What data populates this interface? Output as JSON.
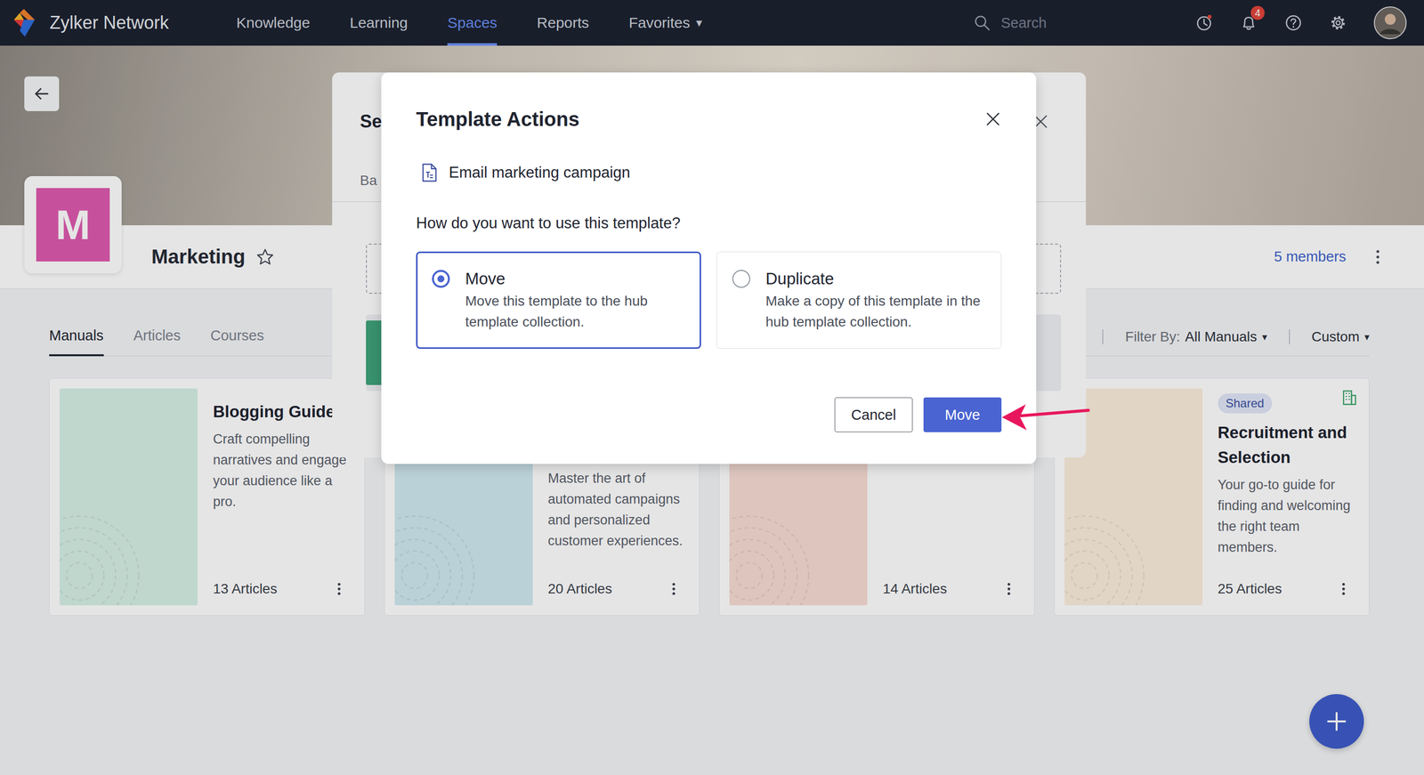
{
  "nav": {
    "brand": "Zylker Network",
    "items": [
      {
        "label": "Knowledge",
        "selected": false,
        "caret": null
      },
      {
        "label": "Learning",
        "selected": false,
        "caret": null
      },
      {
        "label": "Spaces",
        "selected": true,
        "caret": null
      },
      {
        "label": "Reports",
        "selected": false,
        "caret": null
      },
      {
        "label": "Favorites",
        "selected": false,
        "caret": "▾"
      }
    ],
    "search_placeholder": "Search",
    "notification_count": "4"
  },
  "space": {
    "initial": "M",
    "name": "Marketing",
    "members": "5 members"
  },
  "tabs": [
    {
      "label": "Manuals",
      "selected": true
    },
    {
      "label": "Articles",
      "selected": false
    },
    {
      "label": "Courses",
      "selected": false
    }
  ],
  "filter": {
    "label": "Filter By:",
    "value": "All Manuals",
    "caret": "▾"
  },
  "sort": {
    "value": "Custom",
    "caret": "▾"
  },
  "cards": [
    {
      "title": "Blogging Guide",
      "description": "Craft compelling narratives and engage your audience like a pro.",
      "count": "13 Articles",
      "badge": null,
      "color": "#d6f0e6"
    },
    {
      "title": null,
      "description": "Master the art of automated campaigns and personalized customer experiences.",
      "count": "20 Articles",
      "badge": null,
      "color": "#d0e9f1"
    },
    {
      "title": null,
      "description": null,
      "count": "14 Articles",
      "badge": null,
      "color": "#f8ddd4"
    },
    {
      "title": "Recruitment and Selection",
      "description": "Your go-to guide for finding and welcoming the right team members.",
      "count": "25 Articles",
      "badge": "Shared",
      "color": "#fbeedd"
    }
  ],
  "background_dialog": {
    "title": "Se",
    "tab": "Ba"
  },
  "dialog": {
    "title": "Template Actions",
    "template": "Email marketing campaign",
    "question": "How do you want to use this template?",
    "options": [
      {
        "label": "Move",
        "description": "Move this template to the hub template collection.",
        "selected": true
      },
      {
        "label": "Duplicate",
        "description": "Make a copy of this template in the hub template collection.",
        "selected": false
      }
    ],
    "buttons": [
      {
        "label": "Cancel",
        "primary": false
      },
      {
        "label": "Move",
        "primary": true
      }
    ]
  }
}
